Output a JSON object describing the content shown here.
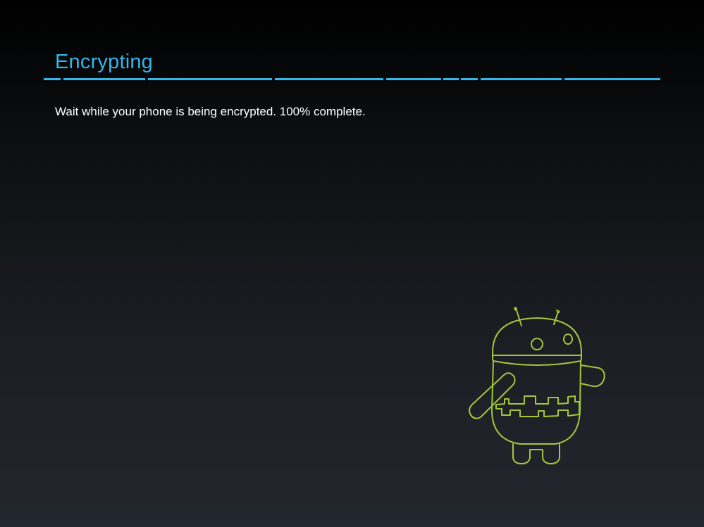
{
  "header": {
    "title": "Encrypting"
  },
  "status": {
    "message": "Wait while your phone is being encrypted. 100% complete.",
    "progress_percent": 100
  },
  "illustration": {
    "name": "android-robot-icon",
    "color": "#a4c639"
  },
  "colors": {
    "accent": "#33b5e5",
    "text": "#ffffff"
  }
}
